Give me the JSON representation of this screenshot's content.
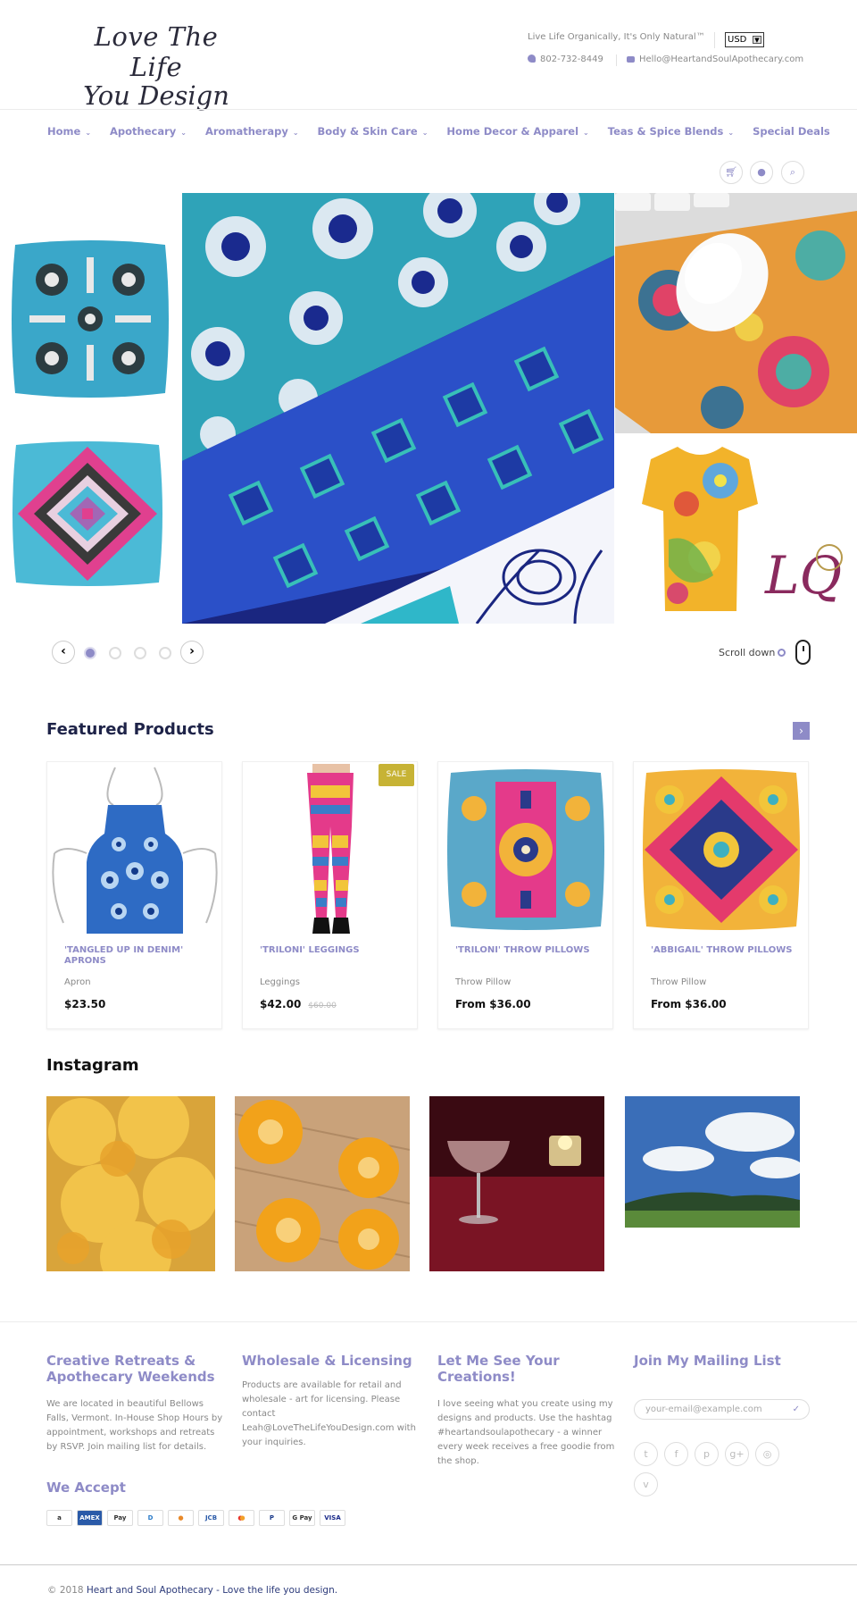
{
  "brand": {
    "logo_line1": "Love The Life",
    "logo_line2": "You Design"
  },
  "header": {
    "tagline": "Live Life Organically, It's Only Natural™",
    "currency": "USD",
    "phone": "802-732-8449",
    "email": "Hello@HeartandSoulApothecary.com"
  },
  "nav": {
    "items": [
      {
        "label": "Home",
        "has_dropdown": true
      },
      {
        "label": "Apothecary",
        "has_dropdown": true
      },
      {
        "label": "Aromatherapy",
        "has_dropdown": true
      },
      {
        "label": "Body & Skin Care",
        "has_dropdown": true
      },
      {
        "label": "Home Decor & Apparel",
        "has_dropdown": true
      },
      {
        "label": "Teas & Spice Blends",
        "has_dropdown": true
      },
      {
        "label": "Special Deals",
        "has_dropdown": false
      }
    ],
    "icons": [
      "cart-icon",
      "user-icon",
      "search-icon"
    ]
  },
  "slider": {
    "prev": "‹",
    "next": "›",
    "dots": 4,
    "active_dot": 0,
    "scroll_label": "Scroll down"
  },
  "featured": {
    "title": "Featured Products",
    "products": [
      {
        "name": "'TANGLED UP IN DENIM' APRONS",
        "type": "Apron",
        "price": "$23.50",
        "old_price": ""
      },
      {
        "name": "'TRILONI' LEGGINGS",
        "type": "Leggings",
        "price": "$42.00",
        "old_price": "$60.00",
        "badge": "SALE"
      },
      {
        "name": "'TRILONI' THROW PILLOWS",
        "type": "Throw Pillow",
        "price": "From $36.00",
        "old_price": ""
      },
      {
        "name": "'ABBIGAIL' THROW PILLOWS",
        "type": "Throw Pillow",
        "price": "From $36.00",
        "old_price": ""
      }
    ]
  },
  "instagram": {
    "title": "Instagram"
  },
  "footer": {
    "col1": {
      "title": "Creative Retreats & Apothecary Weekends",
      "text": "We are located in beautiful Bellows Falls, Vermont. In-House Shop Hours by appointment, workshops and retreats by RSVP. Join mailing list for details."
    },
    "col2": {
      "title": "Wholesale & Licensing",
      "text": "Products are available for retail and wholesale - art for licensing. Please contact Leah@LoveTheLifeYouDesign.com with your inquiries."
    },
    "col3": {
      "title": "Let Me See Your Creations!",
      "text": "I love seeing what you create using my designs and products. Use the hashtag #heartandsoulapothecary - a winner every week receives a free goodie from the shop."
    },
    "col4": {
      "title": "Join My Mailing List",
      "email_placeholder": "your-email@example.com",
      "social": [
        "twitter-icon",
        "facebook-icon",
        "pinterest-icon",
        "google-plus-icon",
        "instagram-icon",
        "vimeo-icon"
      ]
    },
    "accept_title": "We Accept",
    "payments": [
      "amazon",
      "AMEX",
      "Apple Pay",
      "Diners",
      "Discover",
      "JCB",
      "Mastercard",
      "PayPal",
      "Google Pay",
      "VISA"
    ],
    "copyright_prefix": "© 2018",
    "copyright_link": "Heart and Soul Apothecary - Love the life you design."
  },
  "colors": {
    "accent": "#8e8bc7",
    "dark_title": "#1e2348",
    "sale": "#c7b335"
  }
}
